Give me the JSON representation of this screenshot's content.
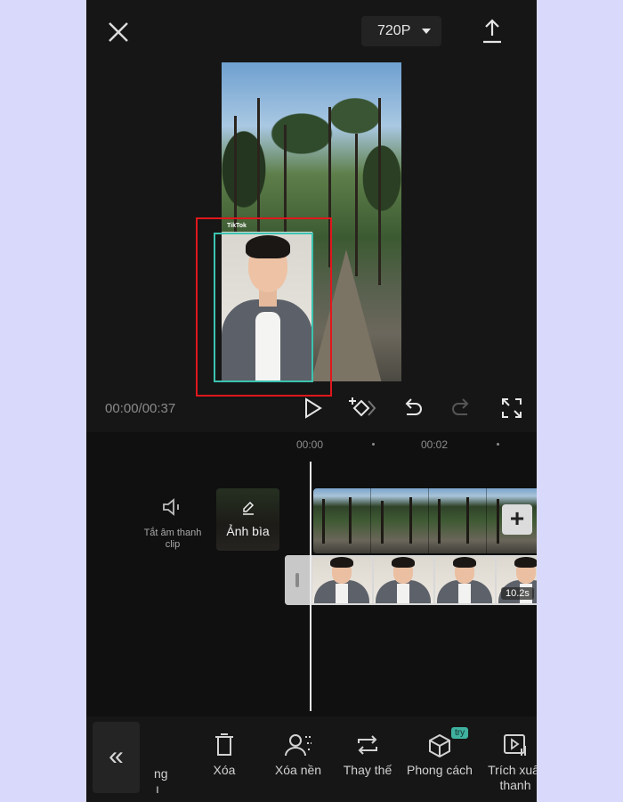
{
  "top_bar": {
    "resolution": "720P"
  },
  "preview": {
    "watermark": "TikTok"
  },
  "playback": {
    "timecode": "00:00/00:37"
  },
  "timeline": {
    "ruler": [
      "00:00",
      "00:02"
    ],
    "mute_label": "Tắt âm thanh clip",
    "cover_label": "Ảnh bìa",
    "overlay_duration": "10.2s",
    "add_clip": "+"
  },
  "toolbar": {
    "clipped_left_1": "ng",
    "clipped_left_2": "ı",
    "tools": [
      {
        "label": "Xóa",
        "icon": "trash-icon"
      },
      {
        "label": "Xóa nền",
        "icon": "remove-background-icon"
      },
      {
        "label": "Thay thế",
        "icon": "replace-icon"
      },
      {
        "label": "Phong cách",
        "icon": "style-cube-icon"
      },
      {
        "label": "Trích xuất",
        "label_line2": "thanh",
        "icon": "extract-audio-icon"
      }
    ],
    "try_badge": "try"
  },
  "colors": {
    "selection_red": "#e0171c",
    "selection_teal": "#3cc3b0",
    "try_badge": "#3fb1a0"
  }
}
